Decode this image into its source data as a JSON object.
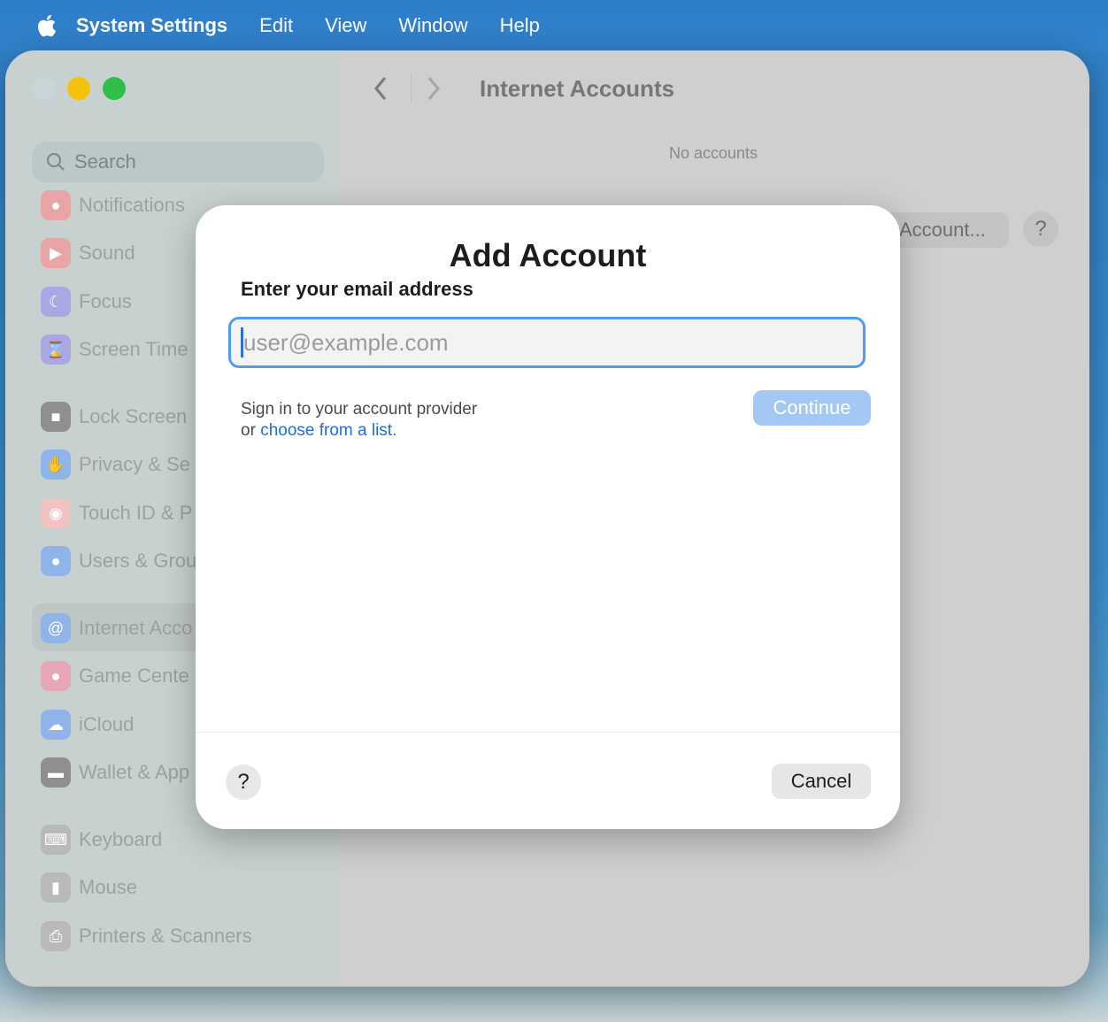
{
  "menubar": {
    "app_name": "System Settings",
    "items": [
      "Edit",
      "View",
      "Window",
      "Help"
    ]
  },
  "window": {
    "title": "Internet Accounts",
    "no_accounts_text": "No accounts",
    "add_account_label": "Account...",
    "help_label": "?"
  },
  "sidebar": {
    "search_placeholder": "Search",
    "items": [
      {
        "label": "Notifications",
        "icon": "bell-icon",
        "color": "#e9a5a5"
      },
      {
        "label": "Sound",
        "icon": "speaker-icon",
        "color": "#e9a5a5"
      },
      {
        "label": "Focus",
        "icon": "moon-icon",
        "color": "#a9a7e4"
      },
      {
        "label": "Screen Time",
        "icon": "hourglass-icon",
        "color": "#a9a7e4"
      },
      {
        "label": "Lock Screen",
        "icon": "lock-icon",
        "color": "#8f8f8f"
      },
      {
        "label": "Privacy & Se",
        "icon": "hand-icon",
        "color": "#8fb4e9"
      },
      {
        "label": "Touch ID & P",
        "icon": "fingerprint-icon",
        "color": "#f0c2c2"
      },
      {
        "label": "Users & Grou",
        "icon": "users-icon",
        "color": "#8fb4e9"
      },
      {
        "label": "Internet Acco",
        "icon": "at-icon",
        "color": "#8fb4e9"
      },
      {
        "label": "Game Cente",
        "icon": "game-center-icon",
        "color": "#e7a7b7"
      },
      {
        "label": "iCloud",
        "icon": "cloud-icon",
        "color": "#8fb4e9"
      },
      {
        "label": "Wallet & App",
        "icon": "wallet-icon",
        "color": "#8f8f8f"
      },
      {
        "label": "Keyboard",
        "icon": "keyboard-icon",
        "color": "#b9b9b9"
      },
      {
        "label": "Mouse",
        "icon": "mouse-icon",
        "color": "#b9b9b9"
      },
      {
        "label": "Printers & Scanners",
        "icon": "printer-icon",
        "color": "#b9b9b9"
      }
    ]
  },
  "dialog": {
    "title": "Add Account",
    "subtitle": "Enter your email address",
    "email_placeholder": "user@example.com",
    "email_value": "",
    "hint_line1": "Sign in to your account provider",
    "hint_prefix": "or ",
    "hint_link": "choose from a list.",
    "continue_label": "Continue",
    "cancel_label": "Cancel",
    "help_label": "?"
  },
  "colors": {
    "accent": "#4f9cf1",
    "link": "#1f6fce",
    "continue_disabled": "#a4c8f4"
  }
}
